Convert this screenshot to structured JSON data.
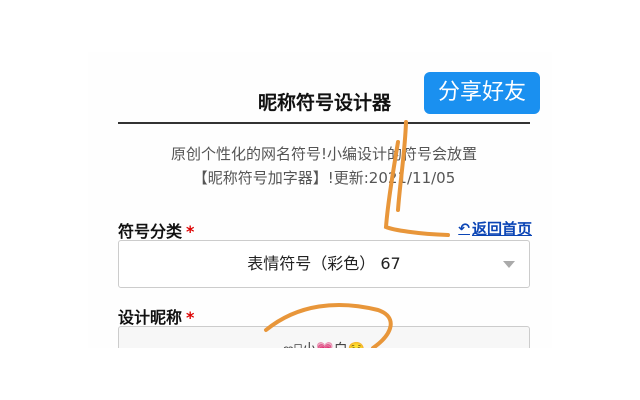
{
  "header": {
    "title": "昵称符号设计器",
    "share_label": "分享好友"
  },
  "intro": {
    "line1": "原创个性化的网名符号!小编设计的符号会放置",
    "line2": "【昵称符号加字器】!更新:2021/11/05"
  },
  "category": {
    "label": "符号分类",
    "required_mark": "*",
    "back_link": "返回首页",
    "back_icon": "↶",
    "selected": "表情符号（彩色） 67"
  },
  "nickname": {
    "label": "设计昵称",
    "required_mark": "*",
    "value": "ღ⃝小💗白☺️"
  }
}
